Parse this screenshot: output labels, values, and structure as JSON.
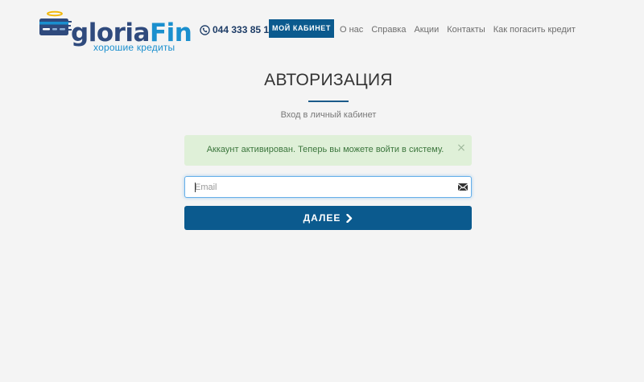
{
  "header": {
    "logo": {
      "name_part1": "gloria",
      "name_part2": "Fin",
      "tagline": "хорошие кредиты"
    },
    "phone": "044 333 85 10",
    "cabinet_button": "МОЙ КАБИНЕТ",
    "nav": [
      "О нас",
      "Справка",
      "Акции",
      "Контакты",
      "Как погасить кредит"
    ]
  },
  "main": {
    "title": "АВТОРИЗАЦИЯ",
    "subtitle": "Вход в личный кабинет",
    "alert": {
      "text": "Аккаунт активирован. Теперь вы можете войти в систему.",
      "close": "×"
    },
    "email": {
      "placeholder": "Email",
      "value": ""
    },
    "next_button": "ДАЛЕЕ"
  },
  "icons": {
    "logo": "credit-card-halo-icon",
    "phone": "phone-icon",
    "alert_close": "close-icon",
    "email": "envelope-icon",
    "next": "chevron-right-icon"
  },
  "colors": {
    "primary": "#0b5a8e",
    "logo_dark": "#2f4a7d",
    "logo_light": "#1a8fce",
    "alert_bg": "#dff0d8",
    "alert_text": "#3c763d",
    "input_focus": "#66afe9",
    "page_bg": "#f4f4f4"
  }
}
